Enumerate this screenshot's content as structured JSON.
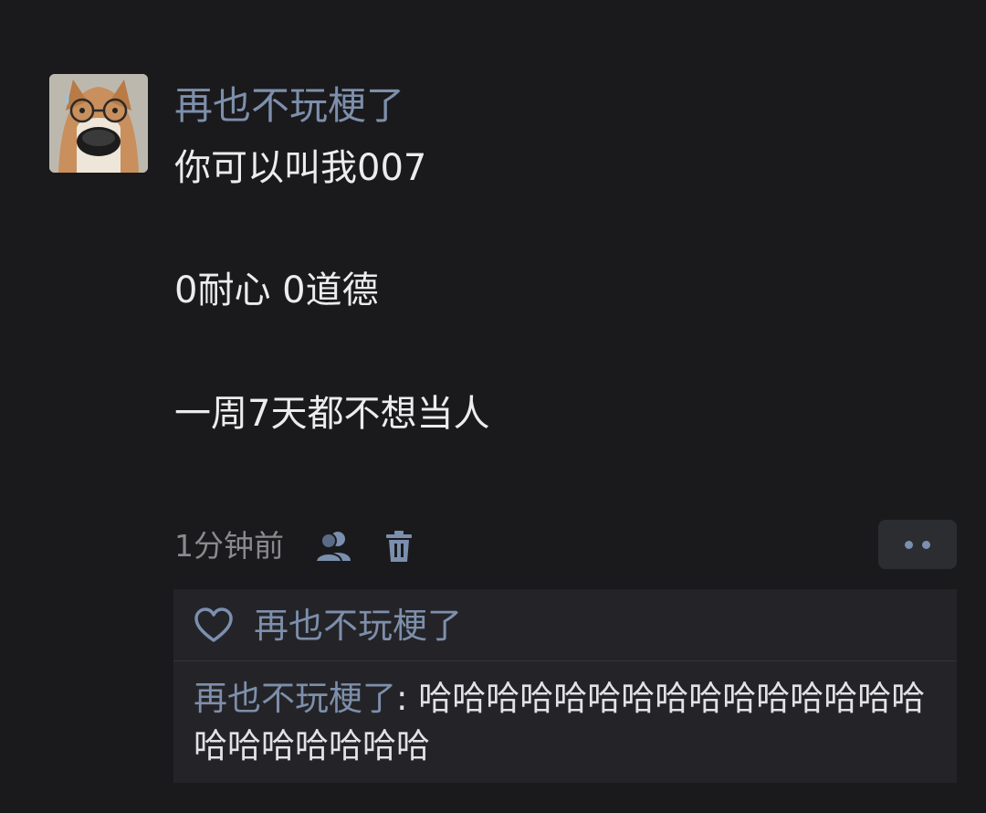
{
  "post": {
    "author_name": "再也不玩梗了",
    "text_lines": [
      "你可以叫我007",
      "0耐心 0道德",
      "一周7天都不想当人"
    ],
    "timestamp": "1分钟前",
    "icons": {
      "visibility": "friends-visibility-icon",
      "delete": "trash-icon",
      "more": "more-dots-icon",
      "like": "heart-icon"
    }
  },
  "likes": {
    "names": "再也不玩梗了"
  },
  "comments": [
    {
      "author": "再也不玩梗了",
      "separator": ": ",
      "text": "哈哈哈哈哈哈哈哈哈哈哈哈哈哈哈哈哈哈哈哈哈哈"
    }
  ],
  "colors": {
    "background": "#1a1a1c",
    "name_link": "#7d8fab",
    "body_text": "#ececee",
    "muted_text": "#8a8a8e",
    "panel": "#242428"
  }
}
